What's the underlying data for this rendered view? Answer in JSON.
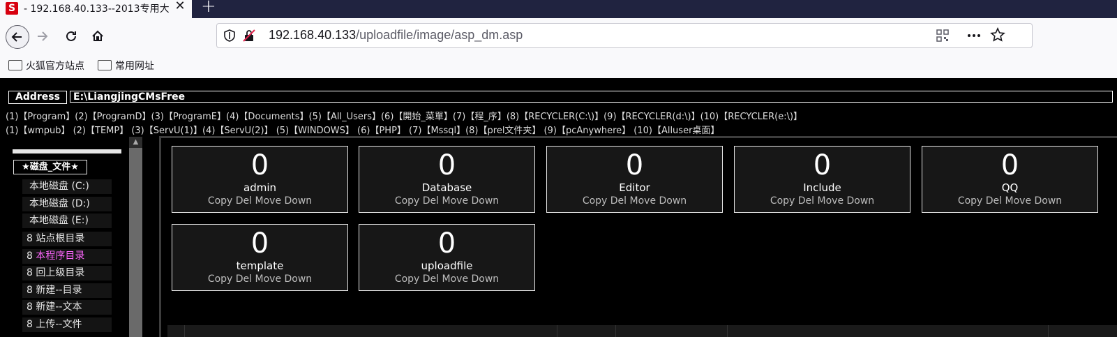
{
  "tab": {
    "title": "- 192.168.40.133--2013专用大",
    "close": "✕",
    "new_tab": "+"
  },
  "url": {
    "host": "192.168.40.133",
    "path": "/uploadfile/image/asp_dm.asp"
  },
  "bookmarks": [
    "火狐官方站点",
    "常用网址"
  ],
  "address": {
    "label": "Address",
    "value": "E:\\LiangjingCMsFree"
  },
  "dir_row1": "(1)【Program】(2)【ProgramD】(3)【ProgramE】(4)【Documents】(5)【All_Users】(6)【開始_菜單】(7)【程_序】(8)【RECYCLER(C:\\)】(9)【RECYCLER(d:\\)】(10)【RECYCLER(e:\\)】",
  "dir_row2": "(1)【wmpub】 (2)【TEMP】   (3)【ServU(1)】(4)【ServU(2)】 (5)【WINDOWS】  (6)【PHP】     (7)【Mssql】(8)【prel文件夹】   (9)【pcAnywhere】 (10)【Alluser桌面】",
  "sidebar": {
    "title": "★磁盘_文件★",
    "drives": [
      "本地磁盘 (C:)",
      "本地磁盘 (D:)",
      "本地磁盘 (E:)"
    ],
    "items": [
      {
        "num": "8",
        "label": "站点根目录",
        "highlight": false
      },
      {
        "num": "8",
        "label": "本程序目录",
        "highlight": true
      },
      {
        "num": "8",
        "label": "回上级目录",
        "highlight": false
      },
      {
        "num": "8",
        "label": "新建--目录",
        "highlight": false
      },
      {
        "num": "8",
        "label": "新建--文本",
        "highlight": false
      },
      {
        "num": "8",
        "label": "上传--文件",
        "highlight": false
      }
    ]
  },
  "folders": [
    {
      "count": "0",
      "name": "admin",
      "actions": "Copy Del Move Down"
    },
    {
      "count": "0",
      "name": "Database",
      "actions": "Copy Del Move Down"
    },
    {
      "count": "0",
      "name": "Editor",
      "actions": "Copy Del Move Down"
    },
    {
      "count": "0",
      "name": "Include",
      "actions": "Copy Del Move Down"
    },
    {
      "count": "0",
      "name": "QQ",
      "actions": "Copy Del Move Down"
    },
    {
      "count": "0",
      "name": "template",
      "actions": "Copy Del Move Down"
    },
    {
      "count": "0",
      "name": "uploadfile",
      "actions": "Copy Del Move Down"
    }
  ],
  "colors": {
    "highlight": "#ff66ff",
    "page_bg": "#000000",
    "card_bg": "#171717"
  }
}
